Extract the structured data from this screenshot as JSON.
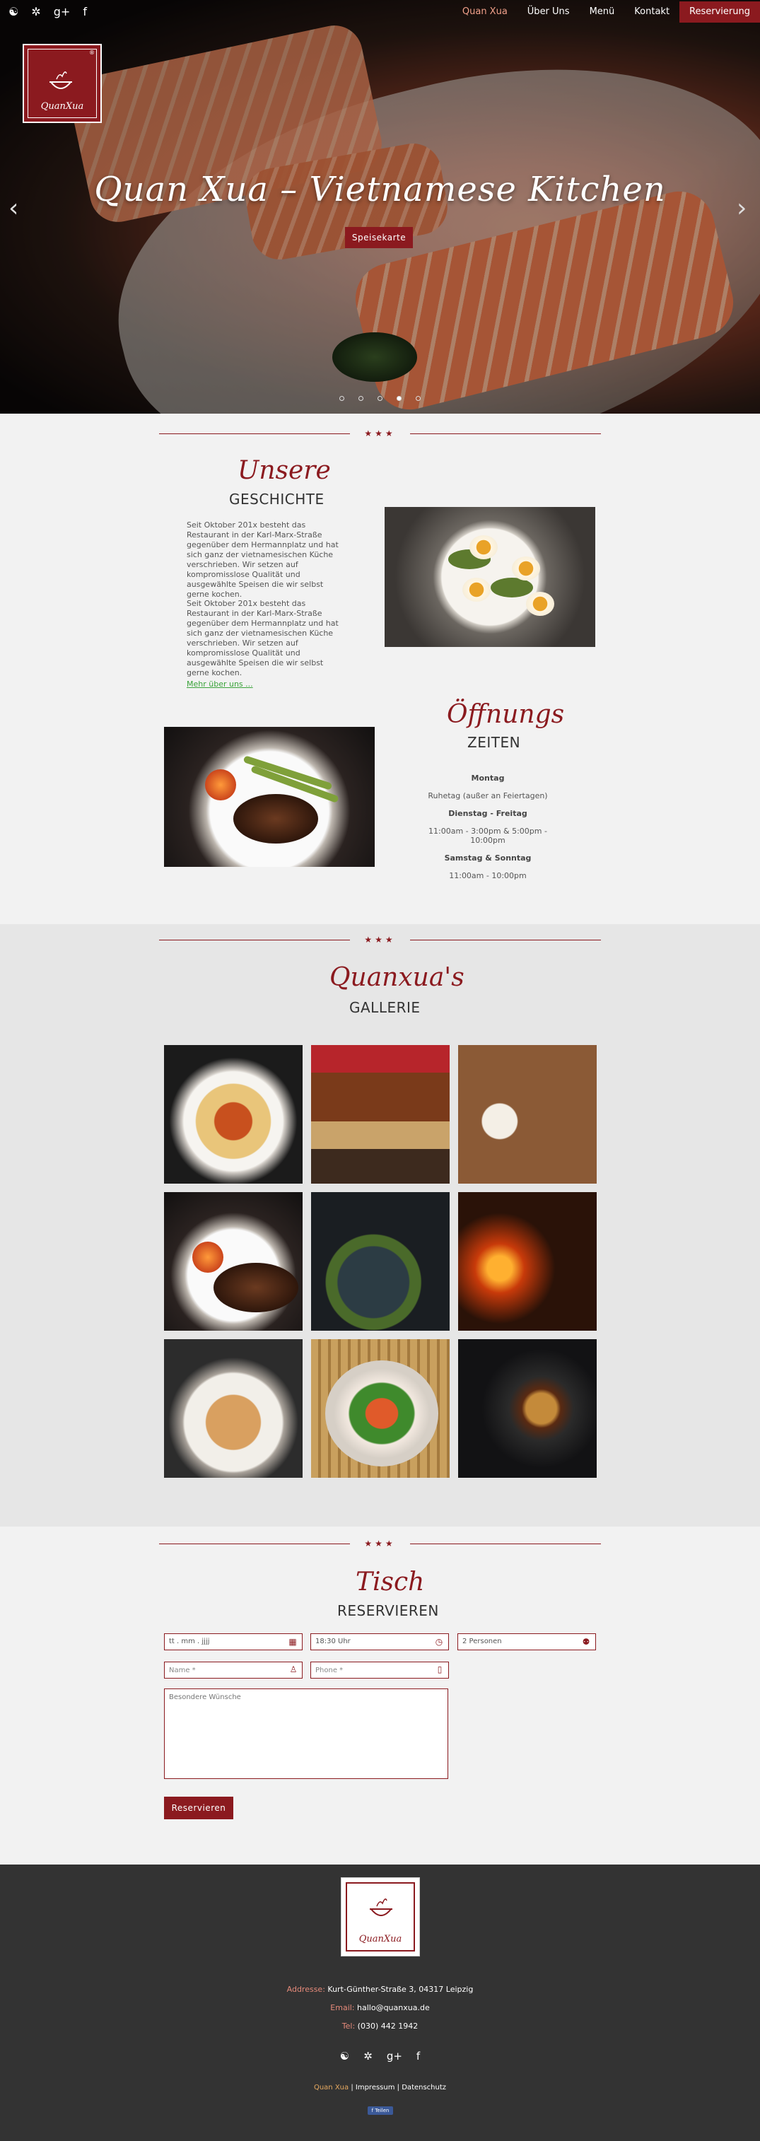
{
  "colors": {
    "brand": "#8b1a1f",
    "accent_nav": "#f0a08a",
    "link_green": "#3aa33a",
    "footer_bg": "#333333"
  },
  "nav": {
    "social": [
      {
        "icon": "tripadvisor-icon",
        "glyph": "☯"
      },
      {
        "icon": "yelp-icon",
        "glyph": "✲"
      },
      {
        "icon": "google-plus-icon",
        "glyph": "g+"
      },
      {
        "icon": "facebook-icon",
        "glyph": "f"
      }
    ],
    "items": [
      "Quan Xua",
      "Über Uns",
      "Menü",
      "Kontakt",
      "Reservierung"
    ]
  },
  "hero": {
    "logo_text": "QuanXua",
    "logo_reg": "®",
    "title": "Quan Xua – Vietnamese Kitchen",
    "button": "Speisekarte",
    "prev_arrow": "‹",
    "next_arrow": "›",
    "active_slide": 4,
    "slide_count": 5
  },
  "divider": "★★★",
  "story": {
    "script": "Unsere",
    "caps": "GESCHICHTE",
    "para1": "Seit Oktober 201x besteht das Restaurant in der Karl-Marx-Straße gegenüber dem Hermannplatz und hat sich ganz der vietnamesischen Küche verschrieben. Wir setzen auf kompromisslose Qualität und ausgewählte Speisen die wir selbst gerne kochen.",
    "para2": "Seit Oktober 201x besteht das Restaurant in der Karl-Marx-Straße gegenüber dem Hermannplatz und hat sich ganz der vietnamesischen Küche verschrieben. Wir setzen auf kompromisslose Qualität und ausgewählte Speisen die wir selbst gerne kochen.",
    "more": "Mehr über uns ..."
  },
  "hours": {
    "script": "Öffnungs",
    "caps": "ZEITEN",
    "rows": [
      {
        "day": "Montag",
        "time": "Ruhetag (außer an Feiertagen)"
      },
      {
        "day": "Dienstag - Freitag",
        "time": "11:00am - 3:00pm & 5:00pm - 10:00pm"
      },
      {
        "day": "Samstag & Sonntag",
        "time": "11:00am - 10:00pm"
      }
    ]
  },
  "gallery": {
    "script": "Quanxua's",
    "caps": "GALLERIE",
    "tiles": [
      "spaghetti-bolognese",
      "burger-coleslaw",
      "breakfast-table",
      "steak-asparagus",
      "noodles-bowl",
      "flaming-pots",
      "spaghetti-fork",
      "papaya-salad",
      "burger-dark"
    ]
  },
  "reservation": {
    "script": "Tisch",
    "caps": "RESERVIEREN",
    "date_value": "tt . mm . jjjj",
    "time_value": "18:30 Uhr",
    "persons_value": "2 Personen",
    "name_placeholder": "Name *",
    "phone_placeholder": "Phone *",
    "wishes_placeholder": "Besondere Wünsche",
    "button": "Reservieren"
  },
  "footer": {
    "logo_text": "QuanXua",
    "address_label": "Addresse:",
    "address": "Kurt-Günther-Straße 3, 04317 Leipzig",
    "email_label": "Email:",
    "email": "hallo@quanxua.de",
    "tel_label": "Tel:",
    "tel": "(030) 442 1942",
    "brand": "Quan Xua",
    "sep": "|",
    "impressum": "Impressum",
    "datenschutz": "Datenschutz",
    "fb_button": "f Teilen"
  }
}
